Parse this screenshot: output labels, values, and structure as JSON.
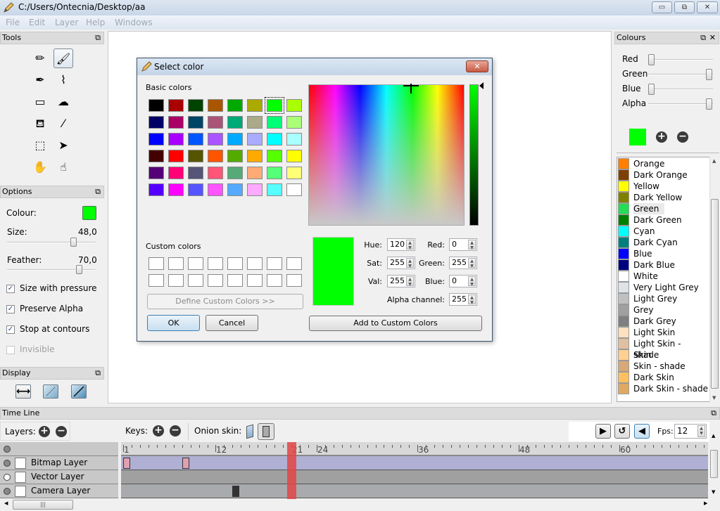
{
  "window": {
    "title": "C:/Users/Ontecnia/Desktop/aa",
    "controls": {
      "minimize": "▭",
      "restore": "⧉",
      "close": "✕"
    }
  },
  "menu": [
    "File",
    "Edit",
    "Layer",
    "Help",
    "Windows"
  ],
  "tools_panel": {
    "title": "Tools",
    "tools": [
      {
        "name": "pencil",
        "glyph": "✏"
      },
      {
        "name": "brush",
        "glyph": "🖌",
        "active": true
      },
      {
        "name": "pen",
        "glyph": "✒"
      },
      {
        "name": "polyline",
        "glyph": "⌇"
      },
      {
        "name": "eraser",
        "glyph": "▭"
      },
      {
        "name": "smudge",
        "glyph": "☁"
      },
      {
        "name": "bucket",
        "glyph": "⛾"
      },
      {
        "name": "eyedropper",
        "glyph": "⁄"
      },
      {
        "name": "select",
        "glyph": "⬚"
      },
      {
        "name": "move",
        "glyph": "➤"
      },
      {
        "name": "hand",
        "glyph": "✋"
      },
      {
        "name": "smudge-finger",
        "glyph": "☝"
      }
    ]
  },
  "options_panel": {
    "title": "Options",
    "colour_label": "Colour:",
    "colour_value": "#00ff00",
    "size_label": "Size:",
    "size_value": "48,0",
    "size_fraction": 0.75,
    "feather_label": "Feather:",
    "feather_value": "70,0",
    "feather_fraction": 0.82,
    "checks": [
      {
        "label": "Size with pressure",
        "checked": true,
        "enabled": true
      },
      {
        "label": "Preserve Alpha",
        "checked": true,
        "enabled": true
      },
      {
        "label": "Stop at contours",
        "checked": true,
        "enabled": true
      },
      {
        "label": "Invisible",
        "checked": false,
        "enabled": false
      }
    ]
  },
  "display_panel": {
    "title": "Display"
  },
  "dialog": {
    "title": "Select color",
    "basic_colors_label": "Basic colors",
    "basic_colors": [
      "#000000",
      "#aa0000",
      "#004400",
      "#aa5500",
      "#00aa00",
      "#aaaa00",
      "#00ff00",
      "#aaff00",
      "#000066",
      "#aa0066",
      "#004466",
      "#aa5577",
      "#00aa77",
      "#aaaa88",
      "#00ff77",
      "#aaff77",
      "#0000ff",
      "#aa00ff",
      "#0055ff",
      "#aa55ff",
      "#00aaff",
      "#aaaaff",
      "#00ffff",
      "#aaffff",
      "#440000",
      "#ff0000",
      "#555500",
      "#ff5500",
      "#55aa00",
      "#ffaa00",
      "#55ff00",
      "#ffff00",
      "#550077",
      "#ff0077",
      "#555577",
      "#ff5577",
      "#55aa77",
      "#ffaa77",
      "#55ff77",
      "#ffff77",
      "#5500ff",
      "#ff00ff",
      "#5555ff",
      "#ff55ff",
      "#55aaff",
      "#ffaaff",
      "#55ffff",
      "#ffffff"
    ],
    "selected_basic_index": 6,
    "custom_colors_label": "Custom colors",
    "define_custom_label": "Define Custom Colors >>",
    "ok_label": "OK",
    "cancel_label": "Cancel",
    "add_custom_label": "Add to Custom Colors",
    "current_color": "#00ff00",
    "fields": {
      "hue_label": "Hue:",
      "hue": "120",
      "sat_label": "Sat:",
      "sat": "255",
      "val_label": "Val:",
      "val": "255",
      "red_label": "Red:",
      "red": "0",
      "green_label": "Green:",
      "green": "255",
      "blue_label": "Blue:",
      "blue": "0",
      "alpha_label": "Alpha channel:",
      "alpha": "255"
    }
  },
  "colours_panel": {
    "title": "Colours",
    "sliders": [
      {
        "label": "Red",
        "fraction": 0.0
      },
      {
        "label": "Green",
        "fraction": 1.0
      },
      {
        "label": "Blue",
        "fraction": 0.0
      },
      {
        "label": "Alpha",
        "fraction": 1.0
      }
    ],
    "current": "#00ff00",
    "items": [
      {
        "name": "Orange",
        "color": "#ff7f00"
      },
      {
        "name": "Dark Orange",
        "color": "#7f3f00"
      },
      {
        "name": "Yellow",
        "color": "#ffff00"
      },
      {
        "name": "Dark Yellow",
        "color": "#7f7f00"
      },
      {
        "name": "Green",
        "color": "#22dd55",
        "highlight": true
      },
      {
        "name": "Dark Green",
        "color": "#007f00"
      },
      {
        "name": "Cyan",
        "color": "#00ffff"
      },
      {
        "name": "Dark Cyan",
        "color": "#007f7f"
      },
      {
        "name": "Blue",
        "color": "#0000ff"
      },
      {
        "name": "Dark Blue",
        "color": "#00007f"
      },
      {
        "name": "White",
        "color": "#ffffff"
      },
      {
        "name": "Very Light Grey",
        "color": "#dfe2e6"
      },
      {
        "name": "Light Grey",
        "color": "#bfc0c2"
      },
      {
        "name": "Grey",
        "color": "#a0a0a0"
      },
      {
        "name": "Dark Grey",
        "color": "#7f7f7f"
      },
      {
        "name": "Light Skin",
        "color": "#ffe0c0"
      },
      {
        "name": "Light Skin - shade",
        "color": "#e0c0a0"
      },
      {
        "name": "Skin",
        "color": "#ffd090"
      },
      {
        "name": "Skin - shade",
        "color": "#d8a878"
      },
      {
        "name": "Dark Skin",
        "color": "#ffc060"
      },
      {
        "name": "Dark Skin - shade",
        "color": "#e0a860"
      }
    ]
  },
  "timeline": {
    "title": "Time Line",
    "layers_label": "Layers:",
    "keys_label": "Keys:",
    "onion_label": "Onion skin:",
    "fps_label": "Fps:",
    "fps": "12",
    "current_frame": 21,
    "ruler_labels": [
      "1",
      "12",
      "21",
      "24",
      "36",
      "48",
      "60"
    ],
    "layers": [
      {
        "name": "Bitmap Layer",
        "keys": [
          1,
          8
        ],
        "visible": true
      },
      {
        "name": "Vector Layer",
        "keys": [],
        "visible": false
      },
      {
        "name": "Camera Layer",
        "keys": [
          14
        ],
        "visible": true
      }
    ]
  }
}
